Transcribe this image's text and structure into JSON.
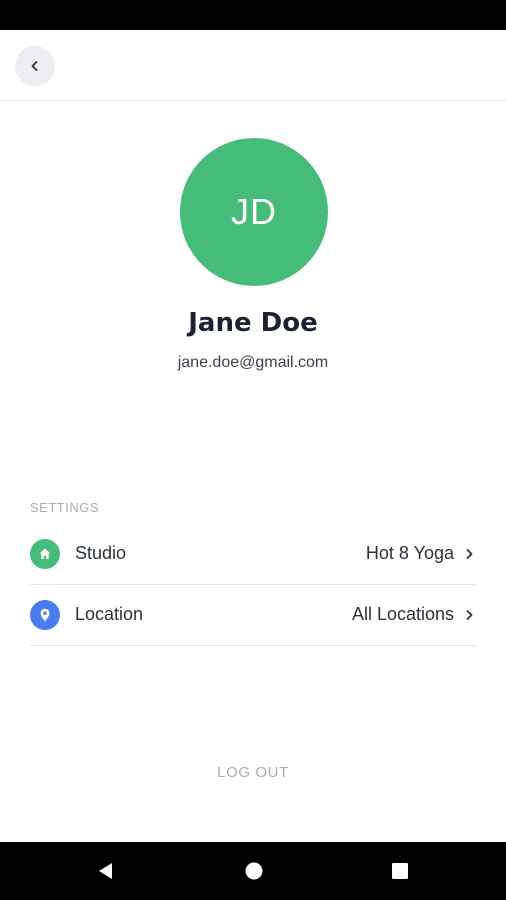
{
  "profile": {
    "initials": "JD",
    "name": "Jane Doe",
    "email": "jane.doe@gmail.com",
    "avatar_color": "#45bc79"
  },
  "settings": {
    "header": "SETTINGS",
    "items": [
      {
        "label": "Studio",
        "value": "Hot 8 Yoga",
        "icon": "home-icon",
        "icon_color": "#45bc79"
      },
      {
        "label": "Location",
        "value": "All Locations",
        "icon": "location-pin-icon",
        "icon_color": "#4a7cf0"
      }
    ]
  },
  "actions": {
    "logout_label": "LOG OUT"
  },
  "icons": {
    "back": "chevron-left-icon",
    "row_arrow": "chevron-right-icon",
    "nav": [
      "nav-back-icon",
      "nav-home-icon",
      "nav-recents-icon"
    ]
  }
}
